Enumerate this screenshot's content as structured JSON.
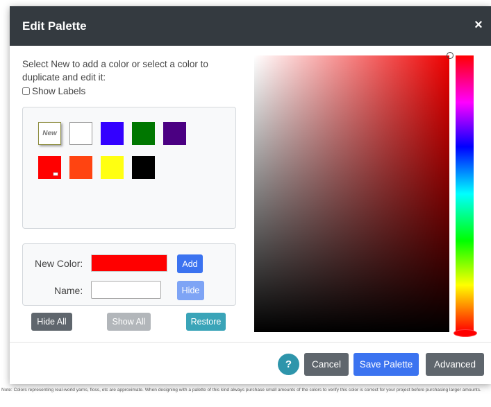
{
  "dialog": {
    "title": "Edit Palette",
    "close_symbol": "×"
  },
  "instructions": "Select New to add a color or select a color to duplicate and edit it:",
  "show_labels": {
    "label": "Show Labels",
    "checked": false
  },
  "palette": {
    "new_label": "New",
    "swatches": [
      {
        "color": "#ffffff"
      },
      {
        "color": "#3300ff"
      },
      {
        "color": "#007700"
      },
      {
        "color": "#4b0082"
      },
      {
        "color": "#ff0000",
        "selected": true
      },
      {
        "color": "#ff4411"
      },
      {
        "color": "#ffff11"
      },
      {
        "color": "#000000"
      }
    ]
  },
  "new_color": {
    "label": "New Color:",
    "color": "#ff0000",
    "add_label": "Add",
    "name_label": "Name:",
    "name_value": "",
    "hide_label": "Hide"
  },
  "buttons": {
    "hide_all": "Hide All",
    "show_all": "Show All",
    "restore": "Restore",
    "help": "?",
    "cancel": "Cancel",
    "save_palette": "Save Palette",
    "advanced": "Advanced"
  },
  "picker": {
    "hue_color": "#ee0000"
  },
  "note": "Note: Colors representing real-world yarns, floss, etc are approximate. When designing with a palette of this kind always purchase small amounts of the colors to verify this color is correct for your project before purchasing larger amounts."
}
